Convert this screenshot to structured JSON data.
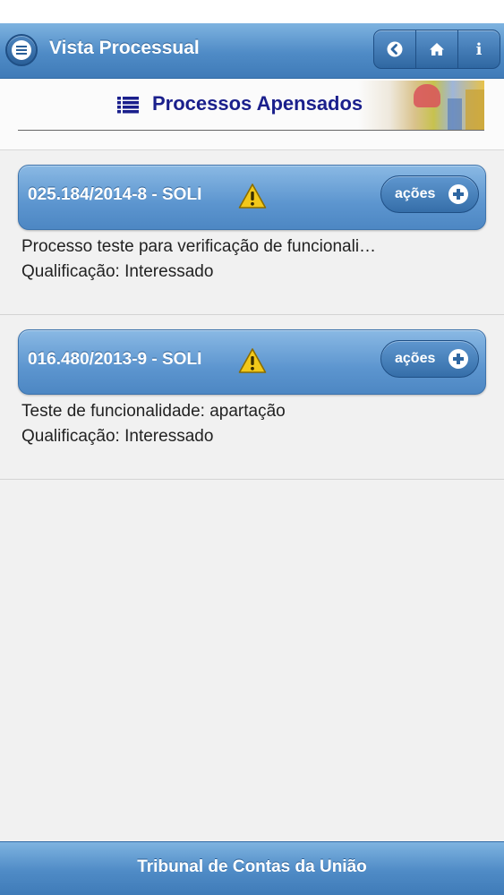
{
  "header": {
    "title": "Vista Processual",
    "menu_icon": "menu-icon",
    "buttons": [
      {
        "icon": "back-icon"
      },
      {
        "icon": "home-icon"
      },
      {
        "icon": "info-icon",
        "glyph": "i"
      }
    ]
  },
  "subheader": {
    "icon": "list-icon",
    "title": "Processos Apensados"
  },
  "processes": [
    {
      "id": "025.184/2014-8 - SOLI",
      "warning_icon": "warning-icon",
      "actions_label": "ações",
      "description": "Processo teste para verificação de funcionali…",
      "qualification": "Qualificação: Interessado"
    },
    {
      "id": "016.480/2013-9 - SOLI",
      "warning_icon": "warning-icon",
      "actions_label": "ações",
      "description": "Teste de funcionalidade: apartação",
      "qualification": "Qualificação: Interessado"
    }
  ],
  "footer": {
    "text": "Tribunal de Contas da União"
  },
  "colors": {
    "header_blue": "#4f8bc6",
    "title_navy": "#1a1f8c",
    "warning_yellow": "#f2c81a"
  }
}
